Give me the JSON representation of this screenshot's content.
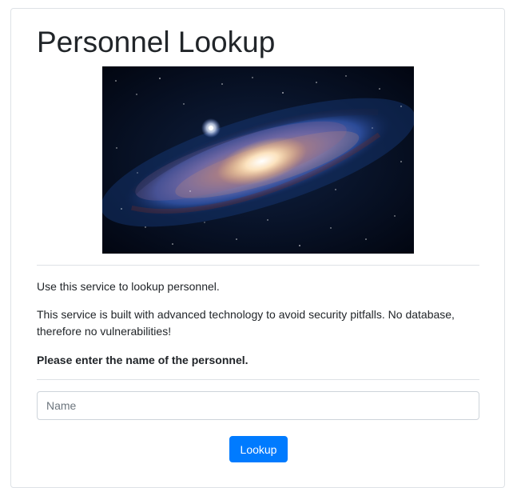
{
  "page": {
    "title": "Personnel Lookup"
  },
  "hero_image": {
    "subject": "spiral galaxy"
  },
  "intro": {
    "line1": "Use this service to lookup personnel.",
    "line2": "This service is built with advanced technology to avoid security pitfalls. No database, therefore no vulnerabilities!",
    "prompt": "Please enter the name of the personnel."
  },
  "form": {
    "name_placeholder": "Name",
    "name_value": "",
    "submit_label": "Lookup"
  },
  "colors": {
    "primary": "#007bff",
    "border": "#dee2e6",
    "text": "#212529"
  }
}
